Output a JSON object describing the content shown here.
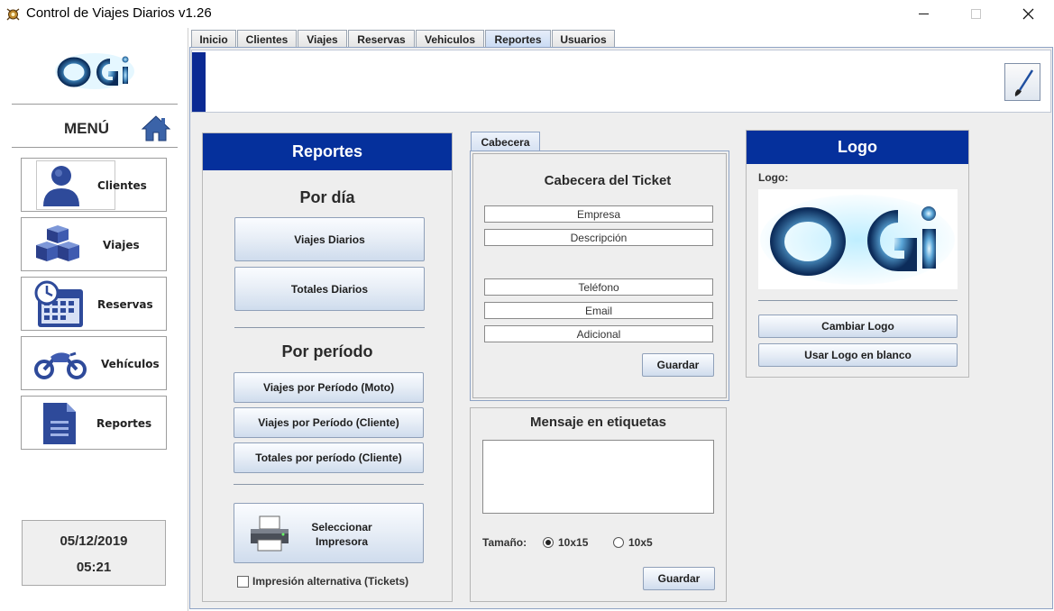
{
  "window": {
    "title": "Control de Viajes Diarios v1.26",
    "minimize_icon": "minimize-icon",
    "maximize_icon": "maximize-icon",
    "close_icon": "close-icon"
  },
  "sidebar": {
    "logo_text": "OGi",
    "menu_label": "MENÚ",
    "home_icon": "home-icon",
    "items": [
      {
        "label": "Clientes",
        "icon": "user-icon"
      },
      {
        "label": "Viajes",
        "icon": "boxes-icon"
      },
      {
        "label": "Reservas",
        "icon": "calendar-clock-icon"
      },
      {
        "label": "Vehículos",
        "icon": "motorcycle-icon"
      },
      {
        "label": "Reportes",
        "icon": "document-icon"
      }
    ],
    "date": "05/12/2019",
    "time": "05:21"
  },
  "tabs": [
    {
      "label": "Inicio"
    },
    {
      "label": "Clientes"
    },
    {
      "label": "Viajes"
    },
    {
      "label": "Reservas"
    },
    {
      "label": "Vehiculos"
    },
    {
      "label": "Reportes",
      "active": true
    },
    {
      "label": "Usuarios"
    }
  ],
  "reportes": {
    "title": "Reportes",
    "por_dia": "Por día",
    "viajes_diarios": "Viajes Diarios",
    "totales_diarios": "Totales Diarios",
    "por_periodo": "Por período",
    "viajes_periodo_moto": "Viajes por Período (Moto)",
    "viajes_periodo_cliente": "Viajes por Período (Cliente)",
    "totales_periodo_cliente": "Totales por período (Cliente)",
    "seleccionar_impresora_1": "Seleccionar",
    "seleccionar_impresora_2": "Impresora",
    "impresion_alternativa": "Impresión alternativa (Tickets)",
    "impresion_alternativa_checked": false
  },
  "cabecera": {
    "tab_label": "Cabecera",
    "title": "Cabecera del Ticket",
    "fields": {
      "empresa": "Empresa",
      "descripcion": "Descripción",
      "telefono": "Teléfono",
      "email": "Email",
      "adicional": "Adicional"
    },
    "guardar": "Guardar"
  },
  "mensaje": {
    "title": "Mensaje en etiquetas",
    "text": "",
    "tamano_label": "Tamaño:",
    "options": [
      "10x15",
      "10x5"
    ],
    "selected": "10x15",
    "guardar": "Guardar"
  },
  "logo": {
    "title": "Logo",
    "label": "Logo:",
    "logo_text": "OGi",
    "cambiar": "Cambiar Logo",
    "usar_blanco": "Usar Logo en blanco"
  },
  "colors": {
    "accent": "#05309c",
    "logo_glow": "#5fd0ff"
  }
}
